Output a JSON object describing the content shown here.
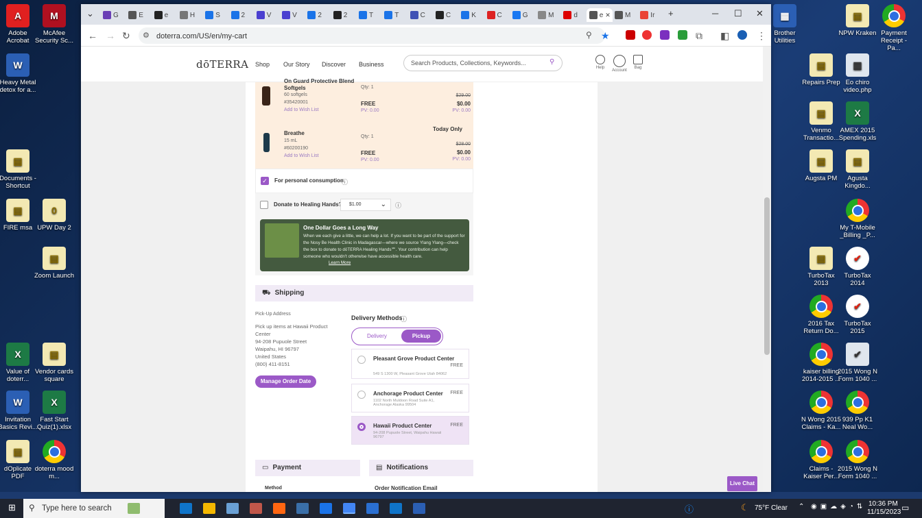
{
  "desktop": {
    "left_icons": [
      {
        "label": "Adobe Acrobat",
        "kind": "pdf",
        "glyph": "A"
      },
      {
        "label": "McAfee Security Sc...",
        "kind": "mc",
        "glyph": "M"
      },
      {
        "label": "Heavy Metal detox for a...",
        "kind": "word",
        "glyph": "W"
      },
      {
        "label": "Documents - Shortcut",
        "kind": "doc",
        "glyph": "▤"
      },
      {
        "label": "FIRE msa",
        "kind": "doc",
        "glyph": "▤"
      },
      {
        "label": "UPW Day 2",
        "kind": "doc",
        "glyph": "0"
      },
      {
        "label": "Zoom Launch",
        "kind": "doc",
        "glyph": "▤"
      },
      {
        "label": "Value of doterr...",
        "kind": "xls",
        "glyph": "X"
      },
      {
        "label": "Vendor cards square",
        "kind": "doc",
        "glyph": "▤"
      },
      {
        "label": "Invitation Basics Revi...",
        "kind": "word",
        "glyph": "W"
      },
      {
        "label": "Fast Start Quiz(1).xlsx",
        "kind": "xls",
        "glyph": "X"
      },
      {
        "label": "dOplicate PDF",
        "kind": "doc",
        "glyph": "▤"
      },
      {
        "label": "doterra mood m...",
        "kind": "chrome",
        "glyph": ""
      }
    ],
    "right_icons": [
      {
        "label": "Brother Utilities",
        "kind": "word",
        "glyph": "▦"
      },
      {
        "label": "NPW Kraken",
        "kind": "doc",
        "glyph": "▤"
      },
      {
        "label": "Payment Receipt - Pa...",
        "kind": "chrome",
        "glyph": ""
      },
      {
        "label": "Repairs Prep",
        "kind": "doc",
        "glyph": "▤"
      },
      {
        "label": "Eo chiro video.php",
        "kind": "gray",
        "glyph": "▥"
      },
      {
        "label": "Venmo Transactio...",
        "kind": "doc",
        "glyph": "▤"
      },
      {
        "label": "AMEX 2015 Spending.xls",
        "kind": "xls",
        "glyph": "X"
      },
      {
        "label": "Augsta PM",
        "kind": "doc",
        "glyph": "▤"
      },
      {
        "label": "Agusta Kingdo...",
        "kind": "doc",
        "glyph": "▤"
      },
      {
        "label": "My T-Mobile _Billing _P...",
        "kind": "chrome",
        "glyph": ""
      },
      {
        "label": "TurboTax 2013",
        "kind": "doc",
        "glyph": "▤"
      },
      {
        "label": "TurboTax 2014",
        "kind": "turbo",
        "glyph": "✔"
      },
      {
        "label": "2016 Tax Return Do...",
        "kind": "chrome",
        "glyph": ""
      },
      {
        "label": "TurboTax 2015",
        "kind": "turbo",
        "glyph": "✔"
      },
      {
        "label": "kaiser billing 2014-2015 ...",
        "kind": "chrome",
        "glyph": ""
      },
      {
        "label": "2015 Wong N Form 1040 ...",
        "kind": "gray",
        "glyph": "✔"
      },
      {
        "label": "N Wong 2015 Claims - Ka...",
        "kind": "chrome",
        "glyph": ""
      },
      {
        "label": "939 Pp K1 Neal Wo...",
        "kind": "chrome",
        "glyph": ""
      },
      {
        "label": "Claims - Kaiser Per...",
        "kind": "chrome",
        "glyph": ""
      },
      {
        "label": "2015 Wong N Form 1040 ...",
        "kind": "chrome",
        "glyph": ""
      }
    ]
  },
  "browser": {
    "url": "doterra.com/US/en/my-cart",
    "tab_letters": [
      "G",
      "E",
      "e",
      "H",
      "S",
      "2",
      "V",
      "V",
      "2",
      "2",
      "T",
      "T",
      "C",
      "C",
      "K",
      "C",
      "G",
      "M",
      "d",
      "e",
      "M",
      "Ir"
    ],
    "tab_colors": [
      "#6a3fb5",
      "#555",
      "#222",
      "#777",
      "#1a73e8",
      "#1a73e8",
      "#4a3fd0",
      "#4a3fd0",
      "#1a73e8",
      "#222",
      "#1a73e8",
      "#1a73e8",
      "#3f51b5",
      "#222",
      "#1a73e8",
      "#d22",
      "#1877f2",
      "#888",
      "#d00",
      "#555",
      "#555",
      "#ea4335"
    ],
    "active_tab_index": 19
  },
  "site": {
    "logo": "dōTERRA",
    "nav": [
      "Shop",
      "Our Story",
      "Discover",
      "Business"
    ],
    "search_placeholder": "Search Products, Collections, Keywords...",
    "header_icons": [
      {
        "label": "Help"
      },
      {
        "label": "Account"
      },
      {
        "label": "Bag"
      }
    ]
  },
  "cart": {
    "items": [
      {
        "name_line1": "On Guard Protective Blend",
        "name_line2": "Softgels",
        "size": "60 softgels",
        "sku": "#35420001",
        "wish": "Add to Wish List",
        "qty": "Qty: 1",
        "free": "FREE",
        "pv": "PV: 0.00",
        "badge": "",
        "old_price": "$29.00",
        "price": "$0.00",
        "pv_right": "PV: 0.00"
      },
      {
        "name_line1": "Breathe",
        "name_line2": "",
        "size": "15 mL",
        "sku": "#60200190",
        "wish": "Add to Wish List",
        "qty": "Qty: 1",
        "free": "FREE",
        "pv": "PV: 0.00",
        "badge": "Today Only",
        "old_price": "$28.00",
        "price": "$0.00",
        "pv_right": "PV: 0.00"
      }
    ],
    "personal_consumption": "For personal consumption",
    "donate_label": "Donate to Healing Hands?",
    "donate_amount": "$1.00",
    "banner_title": "One Dollar Goes a Long Way",
    "banner_text": "When we each give a little, we can help a lot. If you want to be part of the support for the Nosy Be Health Clinic in Madagascar—where we source Ylang Ylang—check the box to donate to dōTERRA Healing Hands℠. Your contribution can help someone who wouldn't otherwise have accessible health care.",
    "banner_link": "Learn More"
  },
  "shipping": {
    "title": "Shipping",
    "pickup_label": "Pick-Up Address",
    "pickup_lines": [
      "Pick up items at Hawaii Product",
      "Center",
      "94-208 Pupuole Street",
      "Waipahu, HI 96797",
      "United States",
      "(800) 411-8151"
    ],
    "manage_btn": "Manage Order Date",
    "delivery_methods": "Delivery Methods",
    "toggle_delivery": "Delivery",
    "toggle_pickup": "Pickup",
    "centers": [
      {
        "name": "Pleasant Grove Product Center",
        "price": "FREE",
        "address": "549 S 1300 W, Pleasant Grove Utah 84062",
        "selected": false
      },
      {
        "name": "Anchorage Product Center",
        "price": "FREE",
        "address": "1102 North Muldoon Road Suite A1, Anchorage Alaska 99504",
        "selected": false
      },
      {
        "name": "Hawaii Product Center",
        "price": "FREE",
        "address": "94-208 Pupuole Street, Waipahu Hawaii 96797",
        "selected": true
      }
    ]
  },
  "payment": {
    "title": "Payment",
    "method": "Method"
  },
  "notifications": {
    "title": "Notifications",
    "email": "Order Notification Email"
  },
  "live_chat": "Live Chat",
  "taskbar": {
    "search": "Type here to search",
    "weather": "75°F  Clear",
    "time": "10:36 PM",
    "date": "11/15/2023"
  }
}
